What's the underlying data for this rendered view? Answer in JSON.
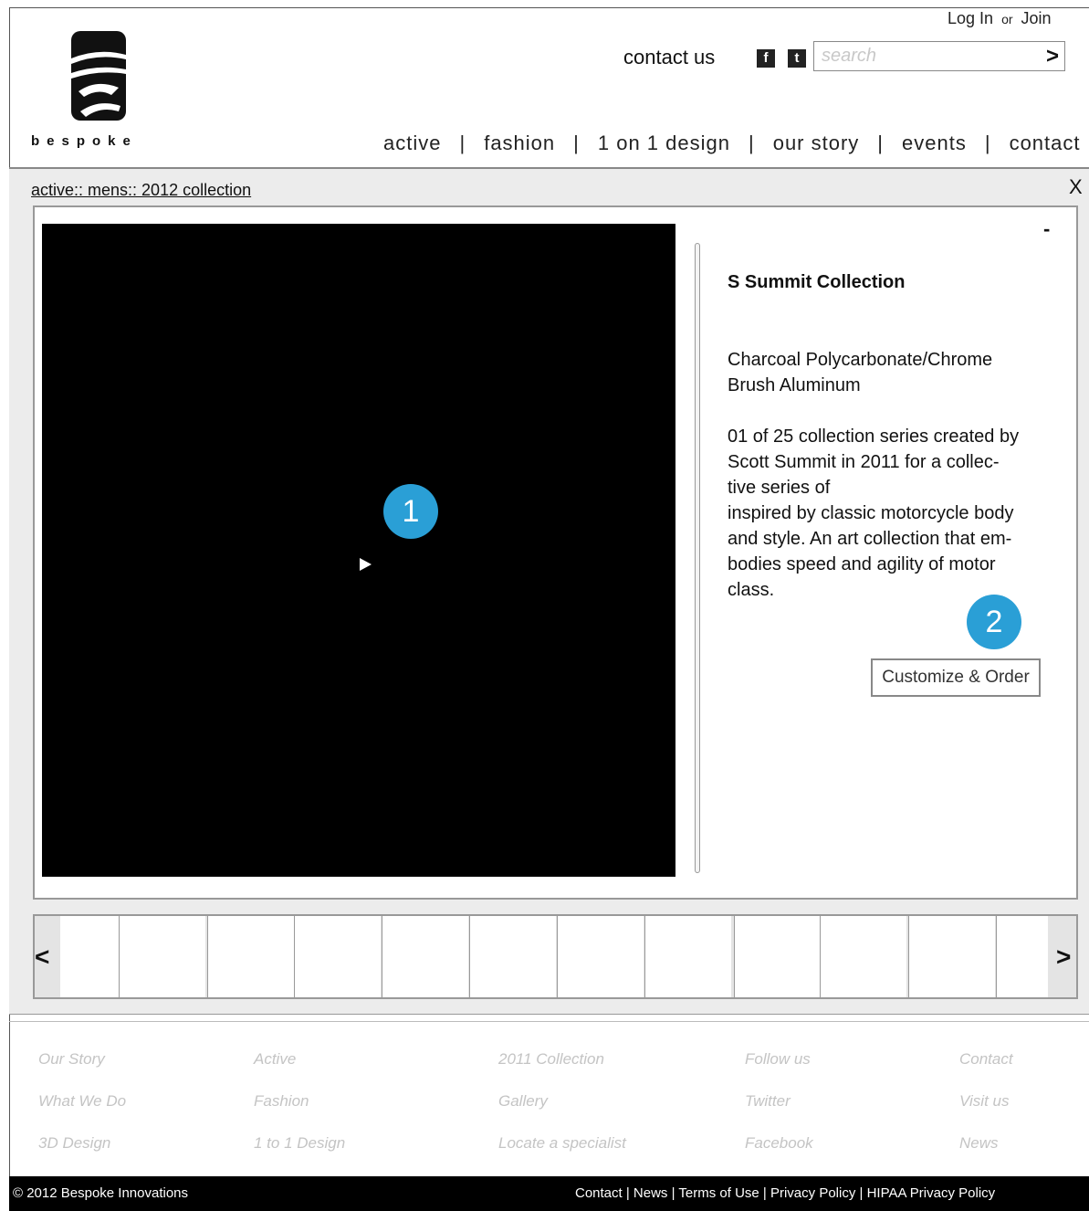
{
  "header": {
    "logo_text": "bespoke",
    "log_in": "Log In",
    "or": "or",
    "join": "Join",
    "contact_us": "contact us",
    "social": [
      "f",
      "t"
    ],
    "search_placeholder": "search",
    "search_go": ">",
    "nav": [
      "active",
      "fashion",
      "1 on 1 design",
      "our story",
      "events",
      "contact"
    ],
    "nav_separator": "|"
  },
  "modal": {
    "breadcrumb": "active:: mens:: 2012 collection",
    "close": "X",
    "minimize": "-",
    "markers": [
      "1",
      "2"
    ],
    "product_title": "S Summit Collection",
    "material_line1": "Charcoal Polycarbonate/Chrome",
    "material_line2": "Brush Aluminum",
    "description": [
      "01 of 25 collection series created by",
      "Scott Summit in 2011 for a collec-",
      "tive series of",
      "inspired by classic motorcycle body",
      "and style. An art collection that em-",
      "bodies speed and agility of motor",
      "class."
    ],
    "order_button": "Customize & Order",
    "prev_arrow": "<",
    "next_arrow": ">"
  },
  "footer": {
    "columns": [
      [
        "Our Story",
        "What We Do",
        "3D Design"
      ],
      [
        "Active",
        "Fashion",
        "1 to 1 Design"
      ],
      [
        "2011 Collection",
        "Gallery",
        "Locate a specialist"
      ],
      [
        "Follow us",
        "Twitter",
        "Facebook"
      ],
      [
        "Contact",
        "Visit us",
        "News"
      ]
    ],
    "copyright": "© 2012 Bespoke Innovations",
    "bottom_links": "Contact | News | Terms of Use | Privacy Policy | HIPAA Privacy Policy"
  },
  "colors": {
    "marker": "#2a9fd6",
    "bottom_bar": "#000000",
    "footer_link": "#c4c4c4"
  }
}
